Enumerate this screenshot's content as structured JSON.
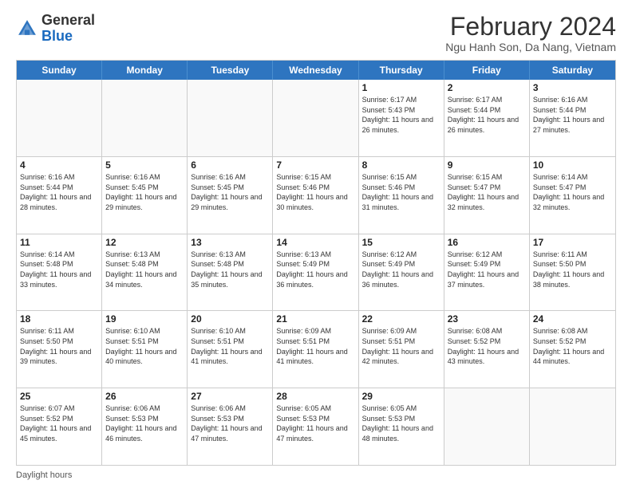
{
  "header": {
    "logo_general": "General",
    "logo_blue": "Blue",
    "title": "February 2024",
    "subtitle": "Ngu Hanh Son, Da Nang, Vietnam"
  },
  "days_of_week": [
    "Sunday",
    "Monday",
    "Tuesday",
    "Wednesday",
    "Thursday",
    "Friday",
    "Saturday"
  ],
  "weeks": [
    [
      {
        "day": "",
        "info": ""
      },
      {
        "day": "",
        "info": ""
      },
      {
        "day": "",
        "info": ""
      },
      {
        "day": "",
        "info": ""
      },
      {
        "day": "1",
        "info": "Sunrise: 6:17 AM\nSunset: 5:43 PM\nDaylight: 11 hours and 26 minutes."
      },
      {
        "day": "2",
        "info": "Sunrise: 6:17 AM\nSunset: 5:44 PM\nDaylight: 11 hours and 26 minutes."
      },
      {
        "day": "3",
        "info": "Sunrise: 6:16 AM\nSunset: 5:44 PM\nDaylight: 11 hours and 27 minutes."
      }
    ],
    [
      {
        "day": "4",
        "info": "Sunrise: 6:16 AM\nSunset: 5:44 PM\nDaylight: 11 hours and 28 minutes."
      },
      {
        "day": "5",
        "info": "Sunrise: 6:16 AM\nSunset: 5:45 PM\nDaylight: 11 hours and 29 minutes."
      },
      {
        "day": "6",
        "info": "Sunrise: 6:16 AM\nSunset: 5:45 PM\nDaylight: 11 hours and 29 minutes."
      },
      {
        "day": "7",
        "info": "Sunrise: 6:15 AM\nSunset: 5:46 PM\nDaylight: 11 hours and 30 minutes."
      },
      {
        "day": "8",
        "info": "Sunrise: 6:15 AM\nSunset: 5:46 PM\nDaylight: 11 hours and 31 minutes."
      },
      {
        "day": "9",
        "info": "Sunrise: 6:15 AM\nSunset: 5:47 PM\nDaylight: 11 hours and 32 minutes."
      },
      {
        "day": "10",
        "info": "Sunrise: 6:14 AM\nSunset: 5:47 PM\nDaylight: 11 hours and 32 minutes."
      }
    ],
    [
      {
        "day": "11",
        "info": "Sunrise: 6:14 AM\nSunset: 5:48 PM\nDaylight: 11 hours and 33 minutes."
      },
      {
        "day": "12",
        "info": "Sunrise: 6:13 AM\nSunset: 5:48 PM\nDaylight: 11 hours and 34 minutes."
      },
      {
        "day": "13",
        "info": "Sunrise: 6:13 AM\nSunset: 5:48 PM\nDaylight: 11 hours and 35 minutes."
      },
      {
        "day": "14",
        "info": "Sunrise: 6:13 AM\nSunset: 5:49 PM\nDaylight: 11 hours and 36 minutes."
      },
      {
        "day": "15",
        "info": "Sunrise: 6:12 AM\nSunset: 5:49 PM\nDaylight: 11 hours and 36 minutes."
      },
      {
        "day": "16",
        "info": "Sunrise: 6:12 AM\nSunset: 5:49 PM\nDaylight: 11 hours and 37 minutes."
      },
      {
        "day": "17",
        "info": "Sunrise: 6:11 AM\nSunset: 5:50 PM\nDaylight: 11 hours and 38 minutes."
      }
    ],
    [
      {
        "day": "18",
        "info": "Sunrise: 6:11 AM\nSunset: 5:50 PM\nDaylight: 11 hours and 39 minutes."
      },
      {
        "day": "19",
        "info": "Sunrise: 6:10 AM\nSunset: 5:51 PM\nDaylight: 11 hours and 40 minutes."
      },
      {
        "day": "20",
        "info": "Sunrise: 6:10 AM\nSunset: 5:51 PM\nDaylight: 11 hours and 41 minutes."
      },
      {
        "day": "21",
        "info": "Sunrise: 6:09 AM\nSunset: 5:51 PM\nDaylight: 11 hours and 41 minutes."
      },
      {
        "day": "22",
        "info": "Sunrise: 6:09 AM\nSunset: 5:51 PM\nDaylight: 11 hours and 42 minutes."
      },
      {
        "day": "23",
        "info": "Sunrise: 6:08 AM\nSunset: 5:52 PM\nDaylight: 11 hours and 43 minutes."
      },
      {
        "day": "24",
        "info": "Sunrise: 6:08 AM\nSunset: 5:52 PM\nDaylight: 11 hours and 44 minutes."
      }
    ],
    [
      {
        "day": "25",
        "info": "Sunrise: 6:07 AM\nSunset: 5:52 PM\nDaylight: 11 hours and 45 minutes."
      },
      {
        "day": "26",
        "info": "Sunrise: 6:06 AM\nSunset: 5:53 PM\nDaylight: 11 hours and 46 minutes."
      },
      {
        "day": "27",
        "info": "Sunrise: 6:06 AM\nSunset: 5:53 PM\nDaylight: 11 hours and 47 minutes."
      },
      {
        "day": "28",
        "info": "Sunrise: 6:05 AM\nSunset: 5:53 PM\nDaylight: 11 hours and 47 minutes."
      },
      {
        "day": "29",
        "info": "Sunrise: 6:05 AM\nSunset: 5:53 PM\nDaylight: 11 hours and 48 minutes."
      },
      {
        "day": "",
        "info": ""
      },
      {
        "day": "",
        "info": ""
      }
    ]
  ],
  "footer": {
    "label": "Daylight hours"
  }
}
